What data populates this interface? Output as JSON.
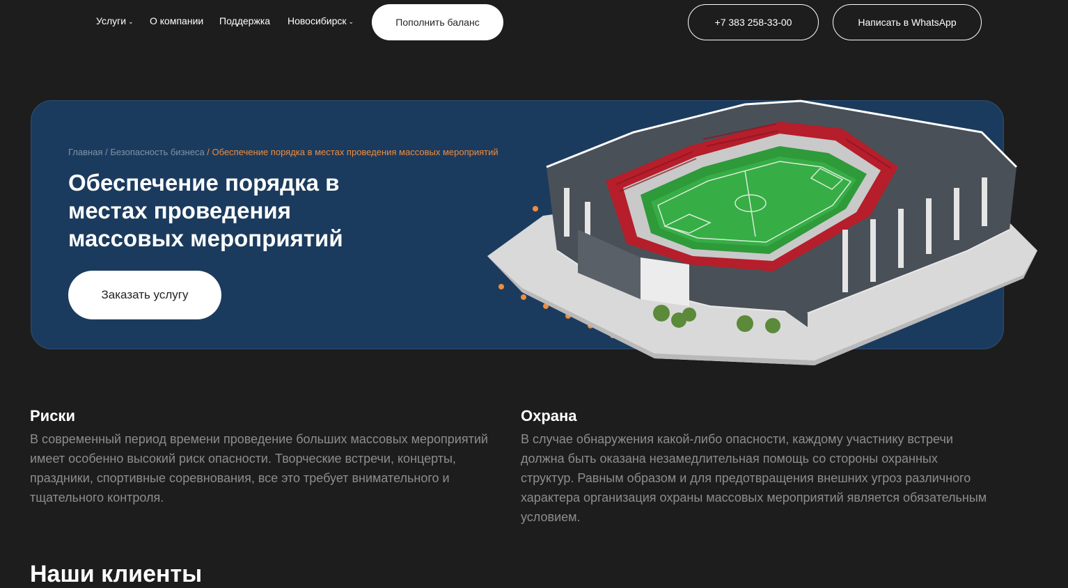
{
  "header": {
    "nav": [
      {
        "label": "Услуги",
        "dropdown": true
      },
      {
        "label": "О компании",
        "dropdown": false
      },
      {
        "label": "Поддержка",
        "dropdown": false
      },
      {
        "label": "Новосибирск",
        "dropdown": true
      }
    ],
    "topup_label": "Пополнить баланс",
    "phone_label": "+7 383 258-33-00",
    "whatsapp_label": "Написать в WhatsApp"
  },
  "hero": {
    "breadcrumb": [
      {
        "label": "Главная"
      },
      {
        "label": "Безопасность бизнеса"
      },
      {
        "label": "Обеспечение порядка в местах проведения массовых мероприятий"
      }
    ],
    "breadcrumb_separator": " / ",
    "title_lines": [
      "Обеспечение порядка в",
      "местах проведения",
      "массовых мероприятий"
    ],
    "order_label": "Заказать услугу",
    "image_icon": "stadium-3d-illustration"
  },
  "sections": [
    {
      "title": "Риски",
      "text": "В современный период времени проведение больших массовых мероприятий имеет особенно высокий риск опасности. Творческие встречи, концерты, праздники, спортивные соревнования, все это требует внимательного и тщательного контроля."
    },
    {
      "title": "Охрана",
      "text": "В случае обнаружения какой-либо опасности, каждому участнику встречи должна быть оказана незамедлительная помощь со стороны охранных структур. Равным образом и для предотвращения внешних угроз различного характера организация охраны массовых мероприятий является обязательным условием."
    }
  ],
  "clients_title": "Наши клиенты",
  "colors": {
    "background": "#1d1d1d",
    "hero_bg": "#1b3b5e",
    "accent": "#f08c3c",
    "muted_text": "#8d8d8d",
    "breadcrumb_text": "#7f93a8"
  }
}
